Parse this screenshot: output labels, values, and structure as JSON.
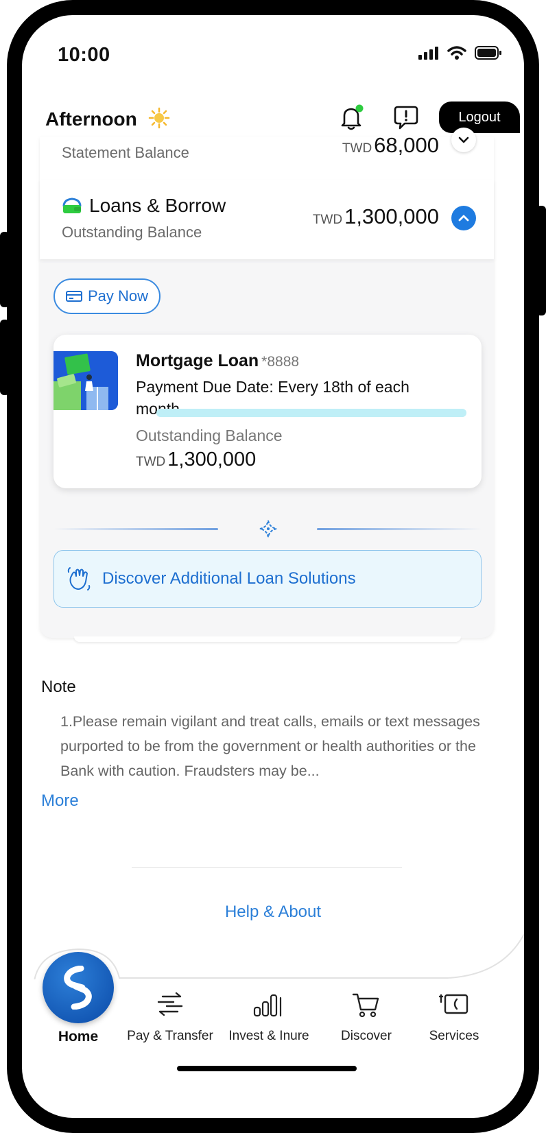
{
  "status_bar": {
    "time": "10:00"
  },
  "header": {
    "greeting": "Afternoon",
    "logout_label": "Logout"
  },
  "accounts": {
    "statement": {
      "label": "Statement Balance",
      "currency": "TWD",
      "amount": "68,000"
    },
    "loans": {
      "title": "Loans & Borrow",
      "subtitle": "Outstanding Balance",
      "currency": "TWD",
      "amount": "1,300,000"
    }
  },
  "pay_now_label": "Pay Now",
  "loan_card": {
    "name": "Mortgage Loan",
    "account_suffix": "*8888",
    "due_line": "Payment Due Date: Every 18th of each month",
    "balance_label": "Outstanding Balance",
    "currency": "TWD",
    "amount": "1,300,000",
    "progress": 1.0
  },
  "discover_label": "Discover Additional Loan Solutions",
  "note": {
    "heading": "Note",
    "body": "1.Please remain vigilant and treat calls, emails or text messages purported to be from the government or health authorities or the Bank with caution. Fraudsters may be...",
    "more_label": "More"
  },
  "help_label": "Help & About",
  "tabs": [
    {
      "label": "Home",
      "icon": "bank-logo-icon"
    },
    {
      "label": "Pay & Transfer",
      "icon": "transfer-arrows-icon"
    },
    {
      "label": "Invest & Inure",
      "icon": "bar-chart-icon"
    },
    {
      "label": "Discover",
      "icon": "cart-icon"
    },
    {
      "label": "Services",
      "icon": "services-card-icon"
    }
  ],
  "colors": {
    "accent": "#1e6fd0",
    "link": "#2b7fd8",
    "notification_dot": "#2ecc40"
  }
}
